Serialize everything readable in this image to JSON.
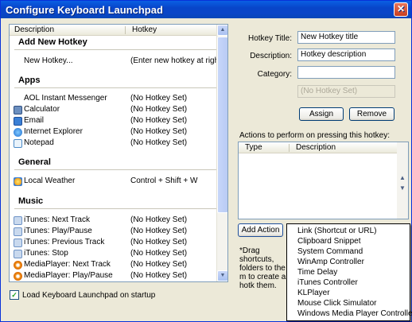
{
  "window": {
    "title": "Configure Keyboard Launchpad",
    "close_glyph": "✕"
  },
  "list": {
    "columns": [
      "Description",
      "Hotkey"
    ],
    "sections": {
      "add": "Add New Hotkey",
      "apps": "Apps",
      "general": "General",
      "music": "Music"
    },
    "rows": [
      {
        "desc": "New Hotkey...",
        "hotkey": "(Enter new hotkey at right)",
        "icon": "none"
      },
      {
        "desc": "AOL Instant Messenger",
        "hotkey": "(No Hotkey Set)",
        "icon": "none"
      },
      {
        "desc": "Calculator",
        "hotkey": "(No Hotkey Set)",
        "icon": "calculator-icon"
      },
      {
        "desc": "Email",
        "hotkey": "(No Hotkey Set)",
        "icon": "email-icon"
      },
      {
        "desc": "Internet Explorer",
        "hotkey": "(No Hotkey Set)",
        "icon": "internet-explorer-icon"
      },
      {
        "desc": "Notepad",
        "hotkey": "(No Hotkey Set)",
        "icon": "notepad-icon"
      },
      {
        "desc": "Local Weather",
        "hotkey": "Control + Shift + W",
        "icon": "weather-icon"
      },
      {
        "desc": "iTunes: Next Track",
        "hotkey": "(No Hotkey Set)",
        "icon": "itunes-icon"
      },
      {
        "desc": "iTunes: Play/Pause",
        "hotkey": "(No Hotkey Set)",
        "icon": "itunes-icon"
      },
      {
        "desc": "iTunes: Previous Track",
        "hotkey": "(No Hotkey Set)",
        "icon": "itunes-icon"
      },
      {
        "desc": "iTunes: Stop",
        "hotkey": "(No Hotkey Set)",
        "icon": "itunes-icon"
      },
      {
        "desc": "MediaPlayer: Next Track",
        "hotkey": "(No Hotkey Set)",
        "icon": "mediaplayer-icon"
      },
      {
        "desc": "MediaPlayer: Play/Pause",
        "hotkey": "(No Hotkey Set)",
        "icon": "mediaplayer-icon"
      }
    ]
  },
  "startup": {
    "label": "Load Keyboard Launchpad on startup",
    "checked": true
  },
  "form": {
    "title_label": "Hotkey Title:",
    "title_value": "New Hotkey title",
    "desc_label": "Description:",
    "desc_value": "Hotkey description",
    "category_label": "Category:",
    "category_value": "",
    "hotkey_value": "(No Hotkey Set)",
    "assign": "Assign",
    "remove": "Remove"
  },
  "actions": {
    "label": "Actions to perform on pressing this hotkey:",
    "columns": [
      "Type",
      "Description"
    ],
    "add_action": "Add Action",
    "drag_text": "*Drag shortcuts, folders to the m to create a hotk them."
  },
  "action_menu": [
    "Link (Shortcut or URL)",
    "Clipboard Snippet",
    "System Command",
    "WinAmp Controller",
    "Time Delay",
    "iTunes Controller",
    "KLPlayer",
    "Mouse Click Simulator",
    "Windows Media Player Controller"
  ],
  "colors": {
    "titlebar": "#0A46C8",
    "window_bg": "#ECE9D8"
  }
}
